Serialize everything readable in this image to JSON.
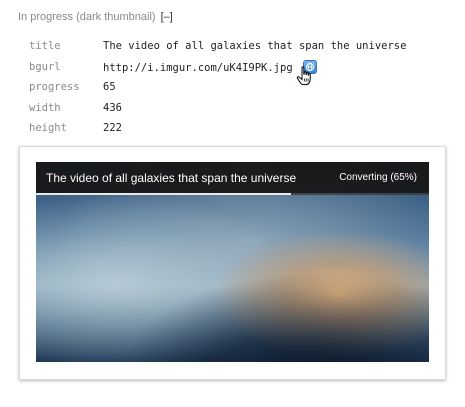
{
  "header": {
    "label": "In progress (dark thumbnail)",
    "toggle": "[–]"
  },
  "props": [
    {
      "key": "title",
      "value": "The video of all galaxies that span the universe"
    },
    {
      "key": "bgurl",
      "value": "http://i.imgur.com/uK4I9PK.jpg"
    },
    {
      "key": "progress",
      "value": "65"
    },
    {
      "key": "width",
      "value": "436"
    },
    {
      "key": "height",
      "value": "222"
    }
  ],
  "icons": {
    "open_link": "globe-link-icon",
    "cursor": "hand-pointer-icon"
  },
  "thumbnail": {
    "title": "The video of all galaxies that span the universe",
    "status": "Converting (65%)",
    "progress_fraction": 0.65,
    "colors": {
      "bar_bg": "#161616",
      "bar_text": "#ffffff",
      "progress_fill": "#e8e8e8",
      "sky_top": "#2b4e74",
      "sky_mid": "#8aa8bc",
      "glow": "#e8b073",
      "ground": "#16293f"
    }
  }
}
